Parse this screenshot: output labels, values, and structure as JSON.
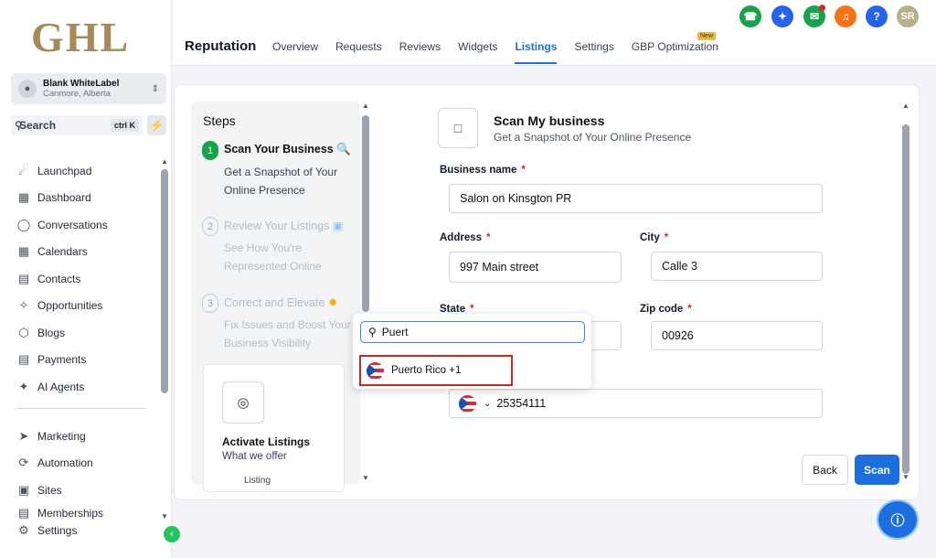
{
  "sidebar": {
    "logo": "GHL",
    "location": {
      "name": "Blank WhiteLabel",
      "place": "Canmore, Alberta"
    },
    "search": {
      "label": "Search",
      "shortcut": "ctrl K"
    },
    "items": [
      {
        "label": "Launchpad",
        "icon": "rocket-icon"
      },
      {
        "label": "Dashboard",
        "icon": "grid-icon"
      },
      {
        "label": "Conversations",
        "icon": "chat-icon"
      },
      {
        "label": "Calendars",
        "icon": "calendar-icon"
      },
      {
        "label": "Contacts",
        "icon": "contacts-icon"
      },
      {
        "label": "Opportunities",
        "icon": "opportunities-icon"
      },
      {
        "label": "Blogs",
        "icon": "cube-icon"
      },
      {
        "label": "Payments",
        "icon": "receipt-icon"
      },
      {
        "label": "AI Agents",
        "icon": "sparkle-icon"
      }
    ],
    "items2": [
      {
        "label": "Marketing",
        "icon": "send-icon"
      },
      {
        "label": "Automation",
        "icon": "automation-icon"
      },
      {
        "label": "Sites",
        "icon": "sites-icon"
      },
      {
        "label": "Memberships",
        "icon": "memberships-icon"
      },
      {
        "label": "Settings",
        "icon": "gear-icon"
      }
    ]
  },
  "header": {
    "title": "Reputation",
    "tabs": [
      "Overview",
      "Requests",
      "Reviews",
      "Widgets",
      "Listings",
      "Settings",
      "GBP Optimization"
    ],
    "active_tab": "Listings",
    "new_badge": "New",
    "user_initials": "SR"
  },
  "steps": {
    "heading": "Steps",
    "items": [
      {
        "num": "1",
        "title": "Scan Your Business",
        "sub": "Get a Snapshot of Your Online Presence"
      },
      {
        "num": "2",
        "title": "Review Your Listings",
        "sub": "See How You're Represented Online"
      },
      {
        "num": "3",
        "title": "Correct and Elevate",
        "sub": "Fix Issues and Boost Your Business Visibility"
      }
    ],
    "activate": {
      "title": "Activate Listings",
      "sub": "What we offer",
      "more": "Listing"
    }
  },
  "form": {
    "title": "Scan My business",
    "subtitle": "Get a Snapshot of Your Online Presence",
    "business_name_label": "Business name",
    "business_name": "Salon on Kinsgton PR",
    "address_label": "Address",
    "address": "997 Main street",
    "city_label": "City",
    "city": "Calle 3",
    "state_label": "State",
    "zip_label": "Zip code",
    "zip": "00926",
    "phone": "25354111",
    "back_label": "Back",
    "scan_label": "Scan"
  },
  "dropdown": {
    "query": "Puert",
    "option": "Puerto Rico +1"
  },
  "colors": {
    "accent": "#1d6fe0",
    "success": "#16a34a",
    "required": "#dc2626"
  }
}
